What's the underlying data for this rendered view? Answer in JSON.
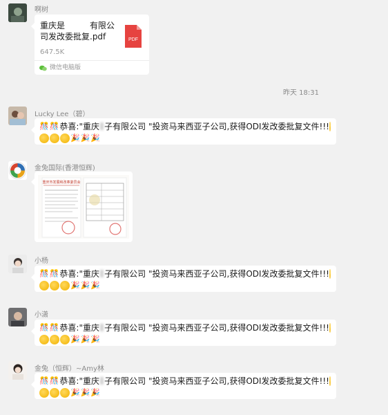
{
  "timestamp": "昨天 18:31",
  "messages": {
    "m1": {
      "sender": "啊树",
      "file_name": "重庆是　　　有限公司发改委批复.pdf",
      "file_size": "647.5K",
      "file_type_label": "PDF",
      "footer": "微信电脑版"
    },
    "m2": {
      "sender": "Lucky Lee（碧）",
      "prefix": "恭喜:\"重庆",
      "rest": "子有限公司 \"投资马来西亚子公司,获得ODI发改委批复文件!!!"
    },
    "m3": {
      "sender": "金兔国际(香港恒辉)",
      "doc_header": "重庆市发展和改革委员会"
    },
    "m4": {
      "sender": "小杨",
      "prefix": "恭喜:\"重庆",
      "rest": "子有限公司 \"投资马来西亚子公司,获得ODI发改委批复文件!!!"
    },
    "m5": {
      "sender": "小潇",
      "prefix": "恭喜:\"重庆",
      "rest": "子有限公司 \"投资马来西亚子公司,获得ODI发改委批复文件!!!"
    },
    "m6": {
      "sender": "金兔（恒辉）~Amy林",
      "prefix": "恭喜:\"重庆",
      "rest": "子有限公司 \"投资马来西亚子公司,获得ODI发改委批复文件!!!"
    }
  },
  "icons": {
    "party": "party-popper-icon",
    "face": "grinning-face-icon",
    "pdf": "pdf-file-icon",
    "wechat": "wechat-icon"
  },
  "colors": {
    "background": "#f1f1f1",
    "bubble": "#ffffff",
    "pdf_red": "#e64340",
    "meta_text": "#8a8a8a"
  }
}
